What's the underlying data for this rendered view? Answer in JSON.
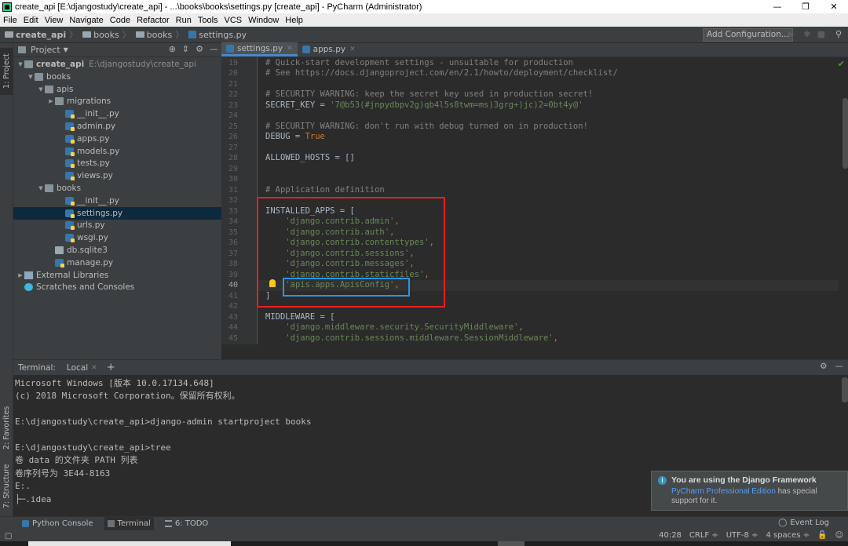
{
  "window": {
    "title": "create_api [E:\\djangostudy\\create_api] - ...\\books\\books\\settings.py [create_api] - PyCharm (Administrator)",
    "controls": [
      "—",
      "❐",
      "✕"
    ]
  },
  "menu": [
    "File",
    "Edit",
    "View",
    "Navigate",
    "Code",
    "Refactor",
    "Run",
    "Tools",
    "VCS",
    "Window",
    "Help"
  ],
  "breadcrumbs": [
    "create_api",
    "books",
    "books",
    "settings.py"
  ],
  "toolbar": {
    "add_config": "Add Configuration...",
    "run_icon": "▶",
    "debug_icon": "✱",
    "stop_icon": "■",
    "search_icon": "⚲"
  },
  "left_strip": {
    "project": "1: Project",
    "favorites": "2: Favorites",
    "structure": "7: Structure"
  },
  "project_panel": {
    "header": "Project",
    "tree": [
      {
        "label": "create_api",
        "sub": "E:\\djangostudy\\create_api",
        "indent": 0,
        "icon": "folder",
        "arrow": "▼",
        "bold": true
      },
      {
        "label": "books",
        "indent": 1,
        "icon": "folder",
        "arrow": "▼"
      },
      {
        "label": "apis",
        "indent": 2,
        "icon": "folder",
        "arrow": "▼"
      },
      {
        "label": "migrations",
        "indent": 3,
        "icon": "folder",
        "arrow": "▶"
      },
      {
        "label": "__init__.py",
        "indent": 4,
        "icon": "py"
      },
      {
        "label": "admin.py",
        "indent": 4,
        "icon": "py"
      },
      {
        "label": "apps.py",
        "indent": 4,
        "icon": "py"
      },
      {
        "label": "models.py",
        "indent": 4,
        "icon": "py"
      },
      {
        "label": "tests.py",
        "indent": 4,
        "icon": "py"
      },
      {
        "label": "views.py",
        "indent": 4,
        "icon": "py"
      },
      {
        "label": "books",
        "indent": 2,
        "icon": "folder",
        "arrow": "▼"
      },
      {
        "label": "__init__.py",
        "indent": 4,
        "icon": "py"
      },
      {
        "label": "settings.py",
        "indent": 4,
        "icon": "py",
        "selected": true
      },
      {
        "label": "urls.py",
        "indent": 4,
        "icon": "py"
      },
      {
        "label": "wsgi.py",
        "indent": 4,
        "icon": "py"
      },
      {
        "label": "db.sqlite3",
        "indent": 3,
        "icon": "db"
      },
      {
        "label": "manage.py",
        "indent": 3,
        "icon": "py"
      },
      {
        "label": "External Libraries",
        "indent": 0,
        "icon": "lib",
        "arrow": "▶"
      },
      {
        "label": "Scratches and Consoles",
        "indent": 0,
        "icon": "scr"
      }
    ]
  },
  "editor": {
    "tabs": [
      {
        "label": "settings.py",
        "active": true
      },
      {
        "label": "apps.py",
        "active": false
      }
    ],
    "current_line": 40,
    "lines": [
      {
        "n": 19,
        "parts": [
          [
            "cm",
            "# Quick-start development settings - unsuitable for production"
          ]
        ]
      },
      {
        "n": 20,
        "parts": [
          [
            "cm",
            "# See https://docs.djangoproject.com/en/2.1/howto/deployment/checklist/"
          ]
        ]
      },
      {
        "n": 21,
        "parts": []
      },
      {
        "n": 22,
        "parts": [
          [
            "cm",
            "# SECURITY WARNING: keep the secret key used in production secret!"
          ]
        ]
      },
      {
        "n": 23,
        "parts": [
          [
            "tx",
            "SECRET_KEY = "
          ],
          [
            "st",
            "'7@b53(#jnpydbpv2g)qb4l5s8twm=ms)3grg+)jc)2=0bt4y@'"
          ]
        ]
      },
      {
        "n": 24,
        "parts": []
      },
      {
        "n": 25,
        "parts": [
          [
            "cm",
            "# SECURITY WARNING: don't run with debug turned on in production!"
          ]
        ]
      },
      {
        "n": 26,
        "parts": [
          [
            "tx",
            "DEBUG = "
          ],
          [
            "kw",
            "True"
          ]
        ]
      },
      {
        "n": 27,
        "parts": []
      },
      {
        "n": 28,
        "parts": [
          [
            "tx",
            "ALLOWED_HOSTS = []"
          ]
        ]
      },
      {
        "n": 29,
        "parts": []
      },
      {
        "n": 30,
        "parts": []
      },
      {
        "n": 31,
        "parts": [
          [
            "cm",
            "# Application definition"
          ]
        ]
      },
      {
        "n": 32,
        "parts": []
      },
      {
        "n": 33,
        "parts": [
          [
            "tx",
            "INSTALLED_APPS = ["
          ]
        ]
      },
      {
        "n": 34,
        "parts": [
          [
            "tx",
            "    "
          ],
          [
            "st",
            "'django.contrib.admin'"
          ],
          [
            "kw",
            ","
          ]
        ]
      },
      {
        "n": 35,
        "parts": [
          [
            "tx",
            "    "
          ],
          [
            "st",
            "'django.contrib.auth'"
          ],
          [
            "kw",
            ","
          ]
        ]
      },
      {
        "n": 36,
        "parts": [
          [
            "tx",
            "    "
          ],
          [
            "st",
            "'django.contrib.contenttypes'"
          ],
          [
            "kw",
            ","
          ]
        ]
      },
      {
        "n": 37,
        "parts": [
          [
            "tx",
            "    "
          ],
          [
            "st",
            "'django.contrib.sessions'"
          ],
          [
            "kw",
            ","
          ]
        ]
      },
      {
        "n": 38,
        "parts": [
          [
            "tx",
            "    "
          ],
          [
            "st",
            "'django.contrib.messages'"
          ],
          [
            "kw",
            ","
          ]
        ]
      },
      {
        "n": 39,
        "parts": [
          [
            "tx",
            "    "
          ],
          [
            "st",
            "'django.contrib.staticfiles'"
          ],
          [
            "kw",
            ","
          ]
        ]
      },
      {
        "n": 40,
        "parts": [
          [
            "tx",
            "    "
          ],
          [
            "st",
            "'apis.apps.ApisConfig'"
          ],
          [
            "kw",
            ","
          ]
        ]
      },
      {
        "n": 41,
        "parts": [
          [
            "tx",
            "]"
          ]
        ]
      },
      {
        "n": 42,
        "parts": []
      },
      {
        "n": 43,
        "parts": [
          [
            "tx",
            "MIDDLEWARE = ["
          ]
        ]
      },
      {
        "n": 44,
        "parts": [
          [
            "tx",
            "    "
          ],
          [
            "st",
            "'django.middleware.security.SecurityMiddleware'"
          ],
          [
            "kw",
            ","
          ]
        ]
      },
      {
        "n": 45,
        "parts": [
          [
            "tx",
            "    "
          ],
          [
            "st",
            "'django.contrib.sessions.middleware.SessionMiddleware'"
          ],
          [
            "kw",
            ","
          ]
        ]
      }
    ]
  },
  "terminal": {
    "header_label": "Terminal:",
    "tab": "Local",
    "lines": [
      "Microsoft Windows [版本 10.0.17134.648]",
      "(c) 2018 Microsoft Corporation。保留所有权利。",
      "",
      "E:\\djangostudy\\create_api>django-admin startproject books",
      "",
      "E:\\djangostudy\\create_api>tree",
      "卷 data 的文件夹 PATH 列表",
      "卷序列号为 3E44-8163",
      "E:.",
      "├─.idea"
    ]
  },
  "notification": {
    "title": "You are using the Django Framework",
    "link": "PyCharm Professional Edition",
    "body_rest": " has special support for it."
  },
  "bottom_tabs": [
    {
      "label": "Python Console",
      "active": false
    },
    {
      "label": "Terminal",
      "active": true
    },
    {
      "label": "6: TODO",
      "active": false
    }
  ],
  "event_log": "Event Log",
  "status": [
    "40:28",
    "CRLF ÷",
    "UTF-8 ÷",
    "4 spaces ÷"
  ]
}
